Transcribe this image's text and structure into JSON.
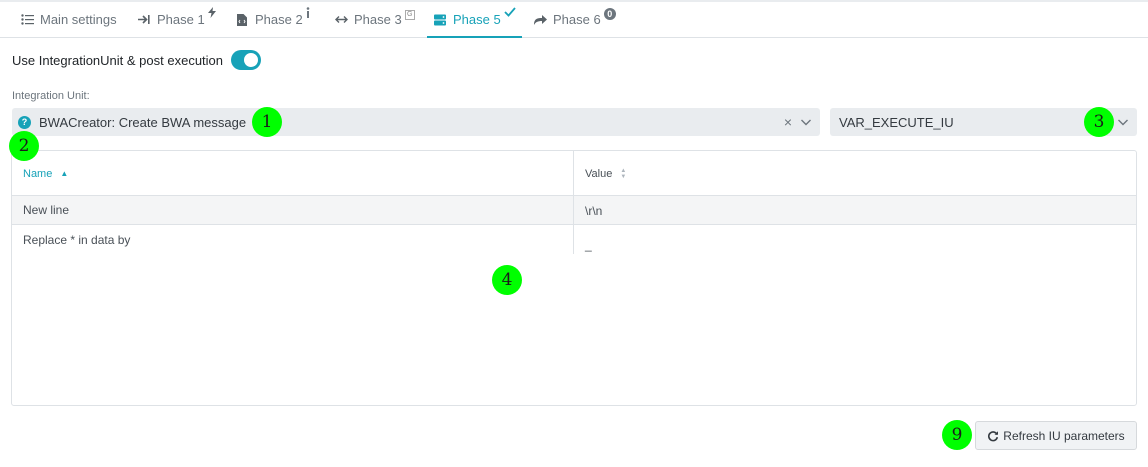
{
  "tabs": [
    {
      "label": "Main settings",
      "icon": "list-icon"
    },
    {
      "label": "Phase 1",
      "icon": "arrow-right-to-line-icon",
      "sup_icon": "bolt-icon"
    },
    {
      "label": "Phase 2",
      "icon": "file-code-icon",
      "sup_icon": "info-icon"
    },
    {
      "label": "Phase 3",
      "icon": "arrows-horizontal-icon",
      "sup_icon": "square-icon"
    },
    {
      "label": "Phase 5",
      "icon": "server-icon",
      "sup_icon": "check-icon",
      "active": true
    },
    {
      "label": "Phase 6",
      "icon": "share-icon",
      "badge": "0"
    }
  ],
  "toggle": {
    "label": "Use IntegrationUnit & post execution",
    "checked": true
  },
  "integration_unit": {
    "label": "Integration Unit:",
    "value": "BWACreator: Create BWA message",
    "help_glyph": "?",
    "clear_glyph": "×"
  },
  "variable_select": {
    "value": "VAR_EXECUTE_IU"
  },
  "table": {
    "columns": [
      {
        "label": "Name",
        "sort": "ascending"
      },
      {
        "label": "Value",
        "sort": "none"
      }
    ],
    "rows": [
      {
        "name": "New line",
        "value": "\\r\\n"
      },
      {
        "name": "Replace * in data by",
        "value": "_"
      }
    ]
  },
  "refresh_button": {
    "label": "Refresh IU parameters",
    "icon": "refresh-icon"
  },
  "markers": [
    "1",
    "2",
    "3",
    "4",
    "9"
  ],
  "colors": {
    "accent": "#17a2b8",
    "marker": "#00ff00",
    "select_bg": "#e9ecef"
  }
}
